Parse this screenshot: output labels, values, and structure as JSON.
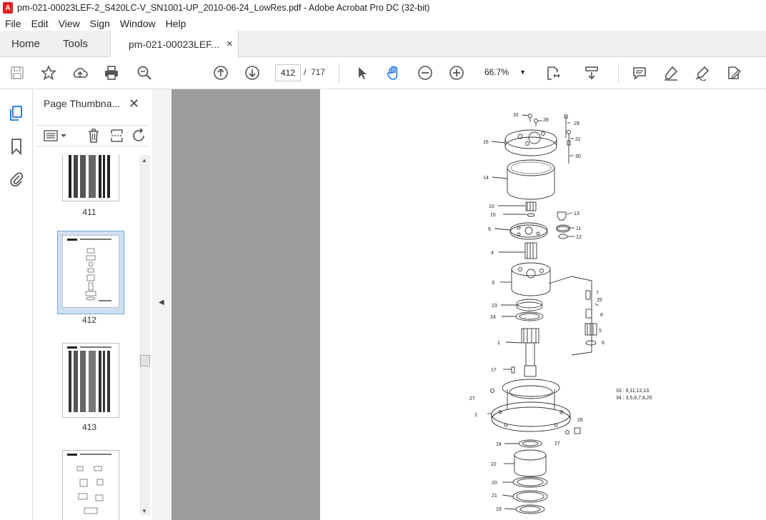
{
  "window": {
    "title": "pm-021-00023LEF-2_S420LC-V_SN1001-UP_2010-06-24_LowRes.pdf - Adobe Acrobat Pro DC (32-bit)",
    "app_icon_letter": "A"
  },
  "menu": [
    "File",
    "Edit",
    "View",
    "Sign",
    "Window",
    "Help"
  ],
  "tabs": {
    "home": "Home",
    "tools": "Tools",
    "document": "pm-021-00023LEF...",
    "close": "×"
  },
  "toolbar": {
    "icons": [
      "save-icon",
      "bookmark-star-icon",
      "upload-icon",
      "print-icon",
      "search-zoom-icon",
      "prev-page-icon",
      "next-page-icon",
      "select-cursor-icon",
      "hand-icon",
      "zoom-out-icon",
      "zoom-in-icon",
      "page-fit-icon",
      "scroll-mode-icon",
      "comment-icon",
      "highlight-icon",
      "sign-icon",
      "fill-sign-icon"
    ],
    "current_page": "412",
    "page_separator": "/",
    "total_pages": "717",
    "zoom": "66.7%"
  },
  "sidebar": {
    "title": "Page Thumbna...",
    "close": "✕",
    "thumbnails": [
      {
        "label": "411",
        "selected": false
      },
      {
        "label": "412",
        "selected": true
      },
      {
        "label": "413",
        "selected": false
      }
    ]
  },
  "collapse_arrow": "◀",
  "diagram": {
    "part_callouts": [
      "32",
      "28",
      "29",
      "31",
      "16",
      "30",
      "14",
      "10",
      "15",
      "13",
      "9",
      "11",
      "12",
      "4",
      "3",
      "7",
      "25",
      "23",
      "8",
      "24",
      "5",
      "6",
      "1",
      "17",
      "27",
      "2",
      "26",
      "27",
      "18",
      "22",
      "20",
      "21",
      "19"
    ],
    "legend": [
      "33 : 9,11,12,13",
      "34 : 3,5,6,7,8,25"
    ]
  }
}
